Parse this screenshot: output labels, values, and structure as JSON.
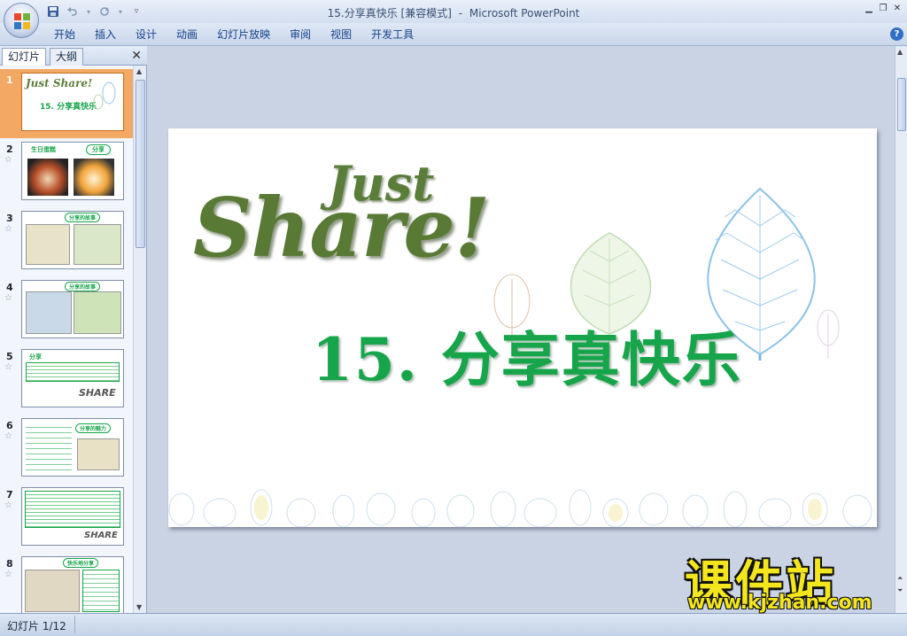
{
  "window": {
    "title_doc": "15.分享真快乐 [兼容模式]",
    "title_sep": "-",
    "title_app": "Microsoft PowerPoint"
  },
  "ribbon": {
    "tabs": [
      "开始",
      "插入",
      "设计",
      "动画",
      "幻灯片放映",
      "审阅",
      "视图",
      "开发工具"
    ]
  },
  "panel": {
    "tab_slides": "幻灯片",
    "tab_outline": "大纲",
    "close": "✕"
  },
  "thumbnails": [
    {
      "num": "1",
      "heading": "15. 分享真快乐",
      "logo": "Just Share!"
    },
    {
      "num": "2",
      "heading": "生日蛋糕",
      "badge": "分享"
    },
    {
      "num": "3",
      "badge": "分享的故事"
    },
    {
      "num": "4",
      "badge": "分享的故事"
    },
    {
      "num": "5",
      "heading": "分享",
      "stamp": "SHARE"
    },
    {
      "num": "6",
      "badge": "分享的魅力"
    },
    {
      "num": "7",
      "stamp": "SHARE"
    },
    {
      "num": "8",
      "badge": "快乐地分享"
    }
  ],
  "slide": {
    "logo_small": "Just",
    "logo_big": "Share!",
    "title": "15. 分享真快乐"
  },
  "status": {
    "slide_counter": "幻灯片 1/12"
  },
  "watermark": {
    "brand": "课件站",
    "url": "www.kjzhan.com"
  },
  "colors": {
    "title_green": "#16a54a",
    "logo_green": "#5b7d3a",
    "active_thumb": "#f3a863",
    "watermark_yellow": "#f3e61c"
  }
}
